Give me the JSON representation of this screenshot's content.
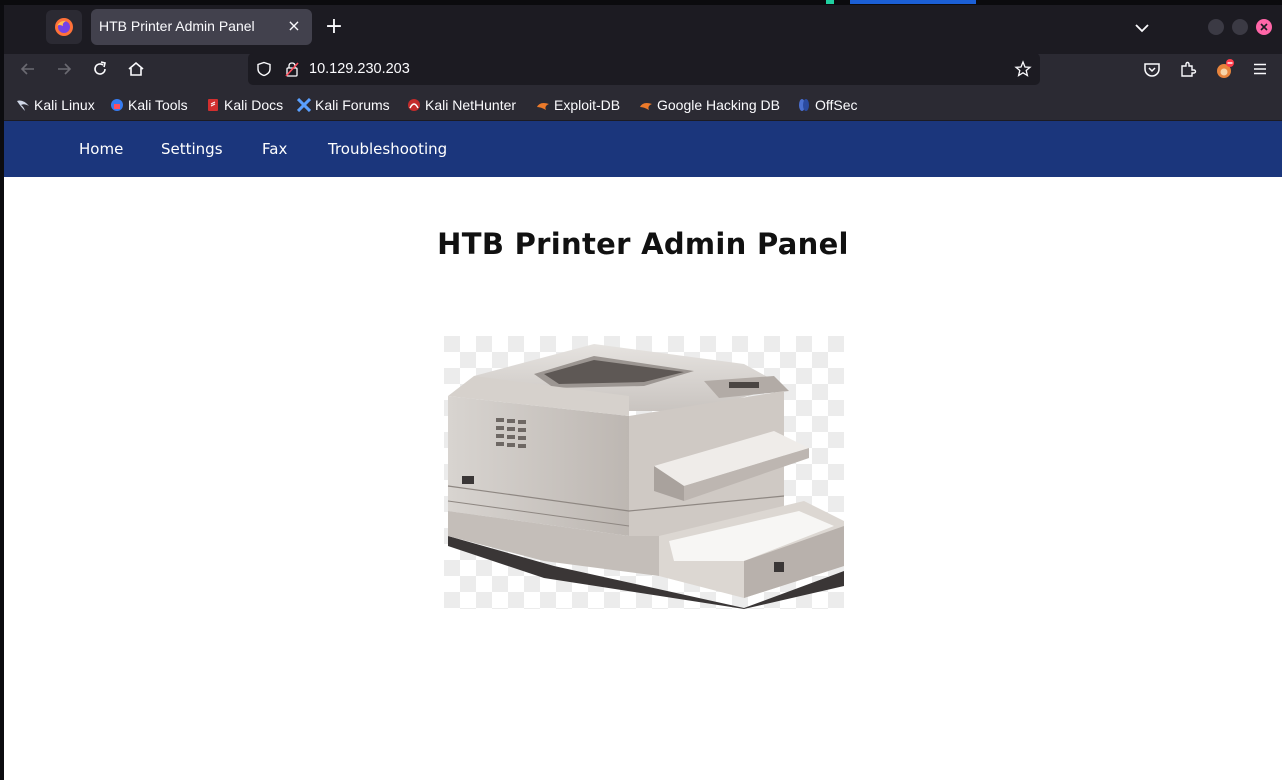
{
  "browser": {
    "tab_title": "HTB Printer Admin Panel",
    "tab_close": "×",
    "new_tab": "+",
    "url": "10.129.230.203"
  },
  "bookmarks": [
    {
      "label": "Kali Linux",
      "icon": "kali-dragon-icon"
    },
    {
      "label": "Kali Tools",
      "icon": "kali-tools-icon"
    },
    {
      "label": "Kali Docs",
      "icon": "kali-docs-icon"
    },
    {
      "label": "Kali Forums",
      "icon": "kali-forums-icon"
    },
    {
      "label": "Kali NetHunter",
      "icon": "kali-nethunter-icon"
    },
    {
      "label": "Exploit-DB",
      "icon": "exploit-db-icon"
    },
    {
      "label": "Google Hacking DB",
      "icon": "ghdb-icon"
    },
    {
      "label": "OffSec",
      "icon": "offsec-icon"
    }
  ],
  "site_nav": {
    "home": "Home",
    "settings": "Settings",
    "fax": "Fax",
    "troubleshooting": "Troubleshooting"
  },
  "main": {
    "heading": "HTB Printer Admin Panel",
    "image": "printer-illustration"
  },
  "colors": {
    "nav_bg": "#1b367c",
    "browser_bg": "#1c1b22",
    "toolbar_bg": "#2b2a33"
  }
}
